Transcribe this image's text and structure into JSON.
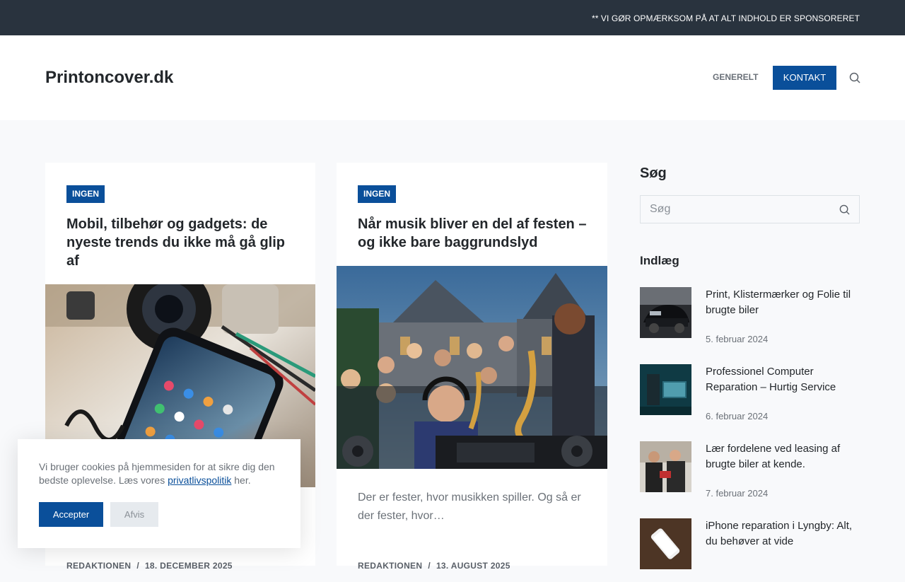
{
  "topbar": {
    "notice": "** VI GØR OPMÆRKSOM PÅ AT ALT INDHOLD ER SPONSORERET"
  },
  "header": {
    "logo": "Printoncover.dk",
    "nav": [
      {
        "label": "GENERELT"
      },
      {
        "label": "KONTAKT"
      }
    ]
  },
  "posts": [
    {
      "category": "INGEN",
      "title": "Mobil, tilbehør og gadgets: de nyeste trends du ikke må gå glip af",
      "excerpt": "",
      "author": "REDAKTIONEN",
      "date": "18. DECEMBER 2025"
    },
    {
      "category": "INGEN",
      "title": "Når musik bliver en del af festen – og ikke bare baggrundslyd",
      "excerpt": "Der er fester, hvor musikken spiller. Og så er der fester, hvor…",
      "author": "REDAKTIONEN",
      "date": "13. AUGUST 2025"
    }
  ],
  "sidebar": {
    "search_heading": "Søg",
    "search_placeholder": "Søg",
    "posts_heading": "Indlæg",
    "recent": [
      {
        "title": "Print, Klistermærker og Folie til brugte biler",
        "date": "5. februar 2024"
      },
      {
        "title": "Professionel Computer Reparation – Hurtig Service",
        "date": "6. februar 2024"
      },
      {
        "title": "Lær fordelene ved leasing af brugte biler at kende.",
        "date": "7. februar 2024"
      },
      {
        "title": "iPhone reparation i Lyngby: Alt, du behøver at vide",
        "date": ""
      }
    ]
  },
  "cookie": {
    "text_before": "Vi bruger cookies på hjemmesiden for at sikre dig den bedste oplevelse. Læs vores ",
    "link": "privatlivspolitik",
    "text_after": " her.",
    "accept": "Accepter",
    "decline": "Afvis"
  },
  "colors": {
    "accent": "#0a4f9a",
    "topbar": "#29333e"
  }
}
